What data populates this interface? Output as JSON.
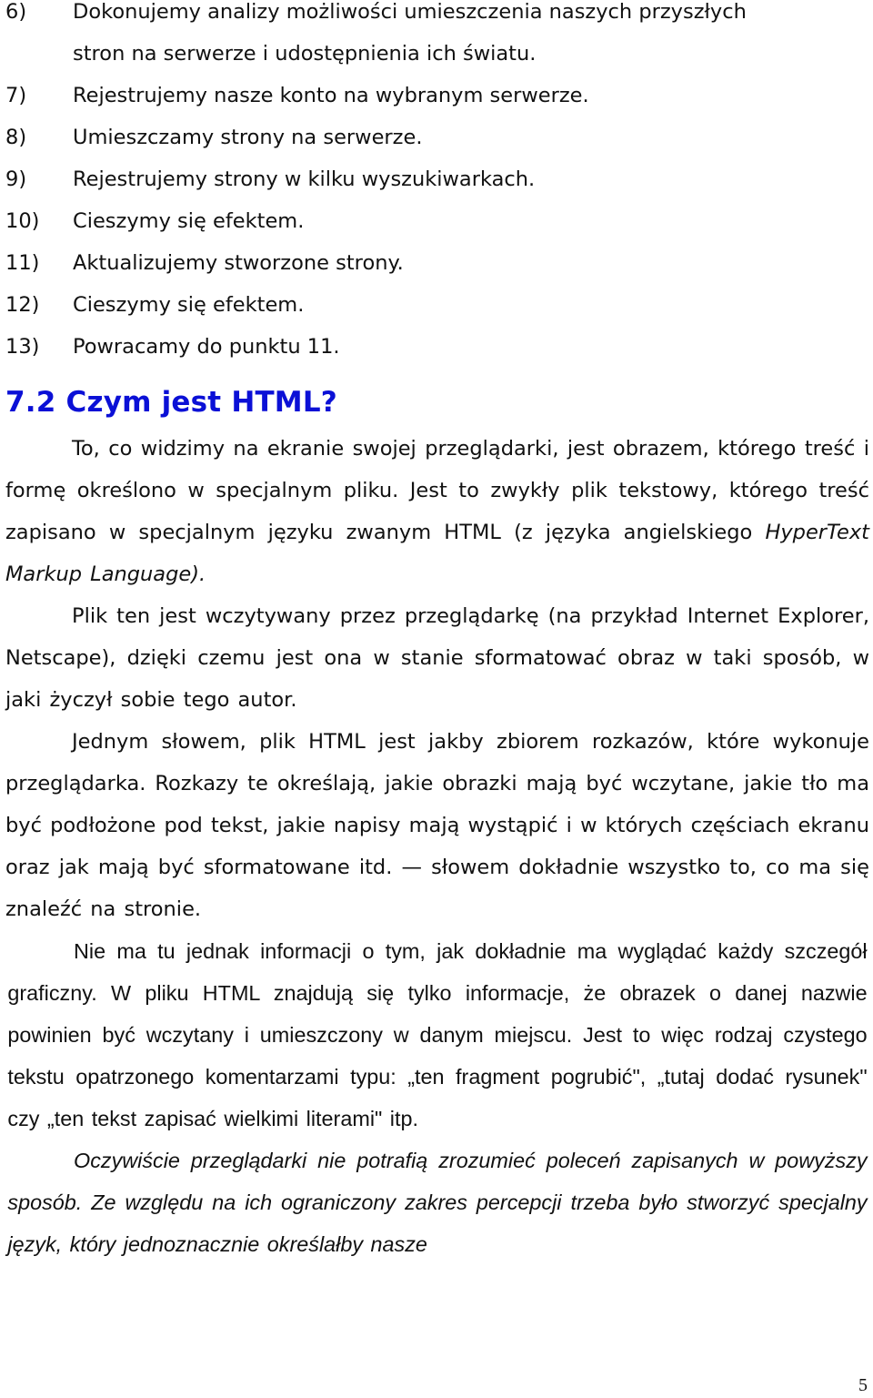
{
  "list": [
    {
      "num": "6)",
      "text": "Dokonujemy analizy możliwości umieszczenia naszych przyszłych",
      "cont": "stron na serwerze i udostępnienia ich światu."
    },
    {
      "num": "7)",
      "text": "Rejestrujemy nasze konto na wybranym serwerze."
    },
    {
      "num": "8)",
      "text": "Umieszczamy strony na serwerze."
    },
    {
      "num": "9)",
      "text": "Rejestrujemy strony w kilku wyszukiwarkach."
    },
    {
      "num": "10)",
      "text": "Cieszymy się efektem."
    },
    {
      "num": "11)",
      "text": "Aktualizujemy stworzone strony."
    },
    {
      "num": "12)",
      "text": "Cieszymy się efektem."
    },
    {
      "num": "13)",
      "text": "Powracamy do punktu 11."
    }
  ],
  "heading": "7.2 Czym jest HTML?",
  "paragraphs": {
    "p1_a": "To, co widzimy na ekranie swojej przeglądarki, jest obrazem, którego treść i formę określono w specjalnym pliku. Jest to zwykły plik tekstowy, którego treść zapisano w specjalnym języku zwanym HTML (z języka angielskiego ",
    "p1_italic": "HyperText Markup Language).",
    "p2": "Plik ten jest wczytywany przez przeglądarkę (na przykład Internet Explorer, Netscape), dzięki czemu jest ona w stanie sformatować obraz w taki sposób, w jaki życzył sobie tego autor.",
    "p3": "Jednym słowem, plik HTML jest jakby zbiorem rozkazów, które wykonuje przeglądarka. Rozkazy te określają, jakie obrazki mają być wczytane, jakie tło ma być podłożone pod tekst, jakie napisy mają wystąpić i w których częściach ekranu oraz jak mają być sformatowane itd. — słowem dokładnie wszystko to, co ma się znaleźć na stronie.",
    "p4": "Nie ma tu jednak informacji o tym, jak dokładnie ma wyglądać każdy szczegół graficzny. W pliku HTML znajdują się tylko informacje, że obrazek o danej nazwie powinien być wczytany i umieszczony w danym miejscu. Jest to więc rodzaj czystego tekstu opatrzonego komentarzami typu: „ten fragment pogrubić\", „tutaj dodać rysunek\" czy „ten tekst zapisać wielkimi literami\" itp.",
    "p5": "Oczywiście przeglądarki nie potrafią zrozumieć poleceń zapisanych w powyższy sposób. Ze względu na ich ograniczony zakres percepcji trzeba było stworzyć specjalny język, który jednoznacznie określałby nasze"
  },
  "page_number": "5",
  "colors": {
    "heading": "#0b10d6",
    "text": "#111111"
  }
}
